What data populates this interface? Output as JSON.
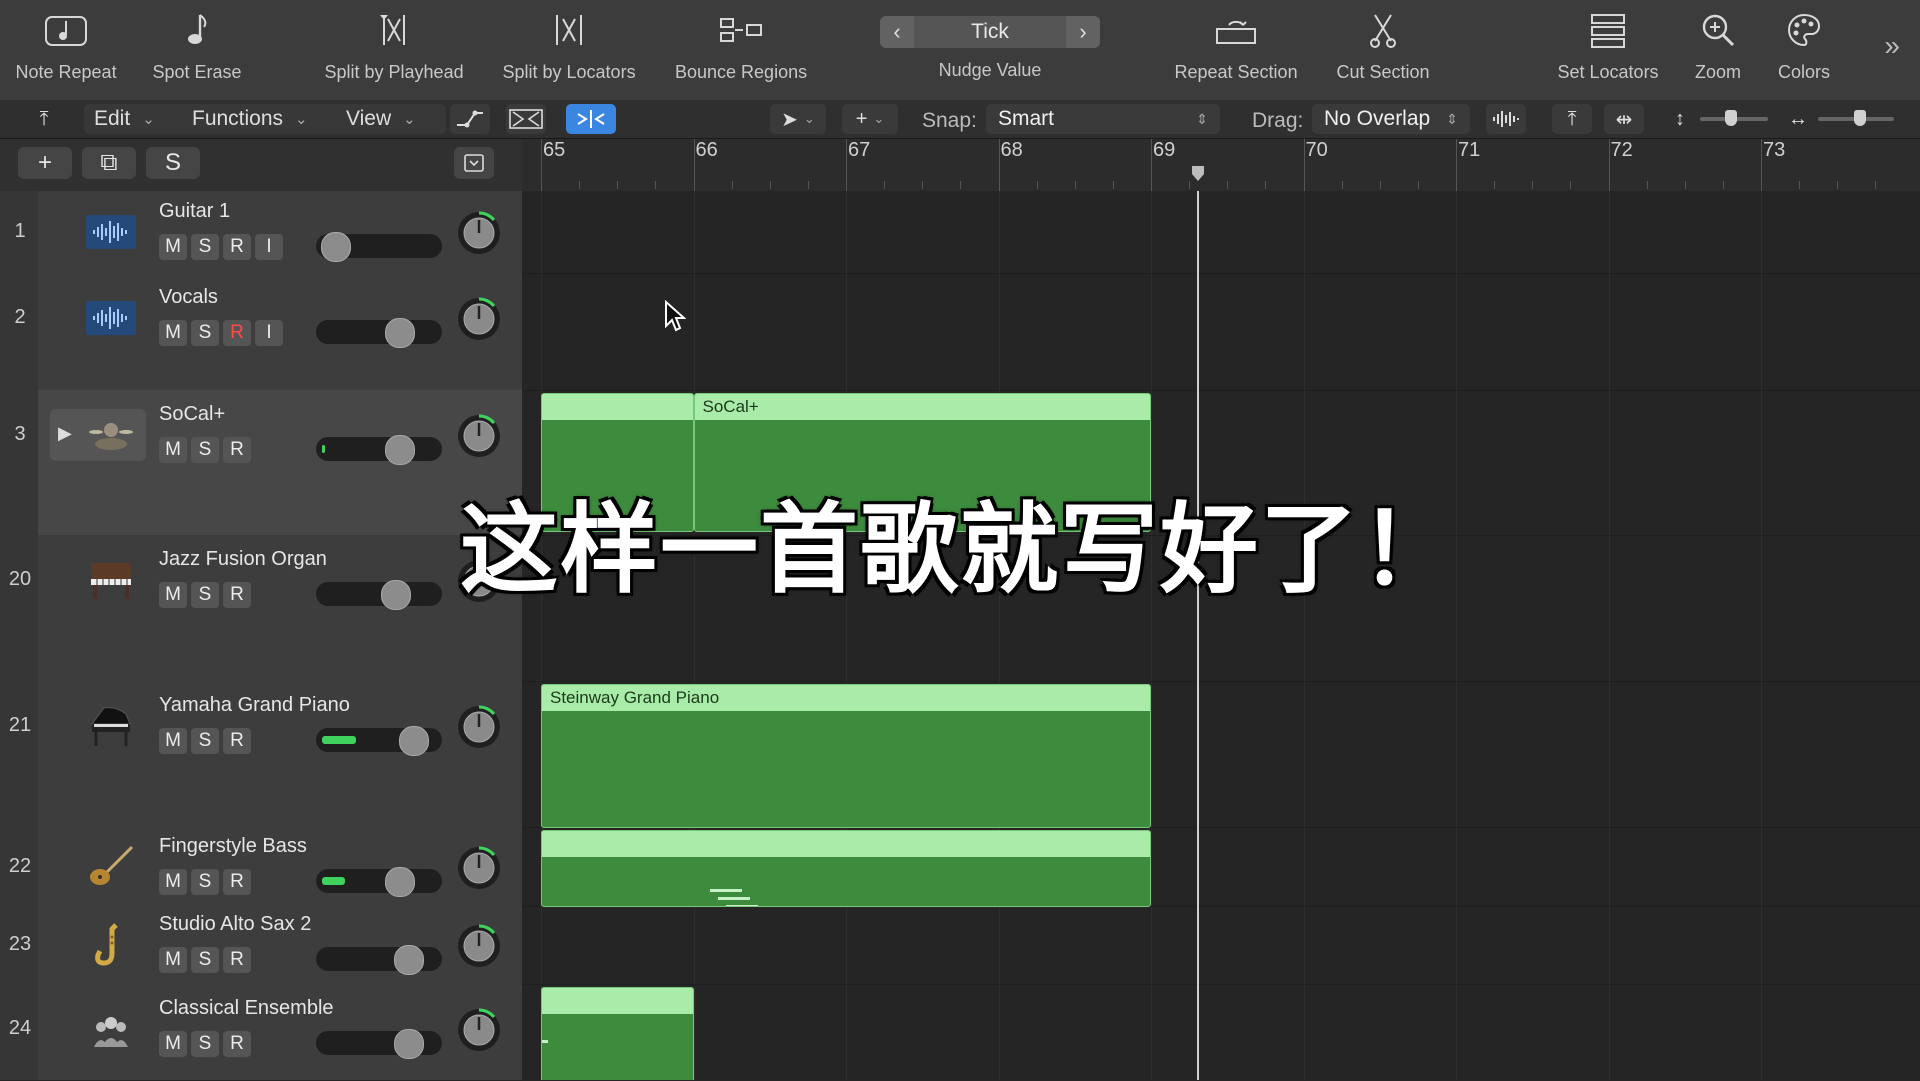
{
  "toolbar": {
    "tools": [
      {
        "label": "Note Repeat",
        "icon": "note-repeat-icon"
      },
      {
        "label": "Spot Erase",
        "icon": "spot-erase-icon"
      },
      {
        "label": "Split by Playhead",
        "icon": "split-playhead-icon"
      },
      {
        "label": "Split by Locators",
        "icon": "split-locators-icon"
      },
      {
        "label": "Bounce Regions",
        "icon": "bounce-regions-icon"
      },
      {
        "label": "Repeat Section",
        "icon": "repeat-section-icon"
      },
      {
        "label": "Cut Section",
        "icon": "cut-section-icon"
      },
      {
        "label": "Set Locators",
        "icon": "set-locators-icon"
      },
      {
        "label": "Zoom",
        "icon": "zoom-icon"
      },
      {
        "label": "Colors",
        "icon": "colors-icon"
      }
    ],
    "nudge": {
      "value": "Tick",
      "label": "Nudge Value"
    },
    "more": "»"
  },
  "secondary": {
    "back": "⤒",
    "menus": [
      {
        "label": "Edit"
      },
      {
        "label": "Functions"
      },
      {
        "label": "View"
      }
    ],
    "snap_label": "Snap:",
    "snap_value": "Smart",
    "drag_label": "Drag:",
    "drag_value": "No Overlap",
    "vertical_zoom_level": 0.45,
    "horizontal_zoom_level": 0.55
  },
  "track_header_buttons": {
    "add": "+",
    "duplicate": "⧉",
    "s": "S"
  },
  "tracks": [
    {
      "num": "1",
      "name": "Guitar 1",
      "buttons": [
        "M",
        "S",
        "R",
        "I"
      ],
      "volume": 0.05,
      "meter": 0,
      "rec_armed": false,
      "icon": "audio-waveform-icon"
    },
    {
      "num": "2",
      "name": "Vocals",
      "buttons": [
        "M",
        "S",
        "R",
        "I"
      ],
      "volume": 0.7,
      "meter": 0,
      "rec_armed": true,
      "icon": "audio-waveform-icon"
    },
    {
      "num": "3",
      "name": "SoCal+",
      "buttons": [
        "M",
        "S",
        "R"
      ],
      "volume": 0.7,
      "meter": 0.03,
      "rec_armed": false,
      "icon": "drummer-icon"
    },
    {
      "num": "20",
      "name": "Jazz Fusion Organ",
      "buttons": [
        "M",
        "S",
        "R"
      ],
      "volume": 0.66,
      "meter": 0,
      "rec_armed": false,
      "icon": "organ-icon"
    },
    {
      "num": "21",
      "name": "Yamaha Grand Piano",
      "buttons": [
        "M",
        "S",
        "R"
      ],
      "volume": 0.85,
      "meter": 0.3,
      "rec_armed": false,
      "icon": "grand-piano-icon"
    },
    {
      "num": "22",
      "name": "Fingerstyle Bass",
      "buttons": [
        "M",
        "S",
        "R"
      ],
      "volume": 0.7,
      "meter": 0.2,
      "rec_armed": false,
      "icon": "bass-guitar-icon"
    },
    {
      "num": "23",
      "name": "Studio Alto Sax 2",
      "buttons": [
        "M",
        "S",
        "R"
      ],
      "volume": 0.8,
      "meter": 0,
      "rec_armed": false,
      "icon": "saxophone-icon"
    },
    {
      "num": "24",
      "name": "Classical Ensemble",
      "buttons": [
        "M",
        "S",
        "R"
      ],
      "volume": 0.8,
      "meter": 0,
      "rec_armed": false,
      "icon": "ensemble-icon"
    }
  ],
  "ruler": {
    "bars": [
      "65",
      "66",
      "67",
      "68",
      "69",
      "70",
      "71",
      "72",
      "73"
    ]
  },
  "regions": [
    {
      "track": 2,
      "start": 65,
      "end": 66,
      "label": ""
    },
    {
      "track": 2,
      "start": 66,
      "end": 69,
      "label": "SoCal+"
    },
    {
      "track": 4,
      "start": 65,
      "end": 69,
      "label": "Steinway Grand Piano"
    },
    {
      "track": 5,
      "start": 65,
      "end": 69,
      "label": ""
    },
    {
      "track": 7,
      "start": 65,
      "end": 66,
      "label": ""
    }
  ],
  "playhead_bar": 69.3,
  "subtitle": "这样一首歌就写好了！"
}
